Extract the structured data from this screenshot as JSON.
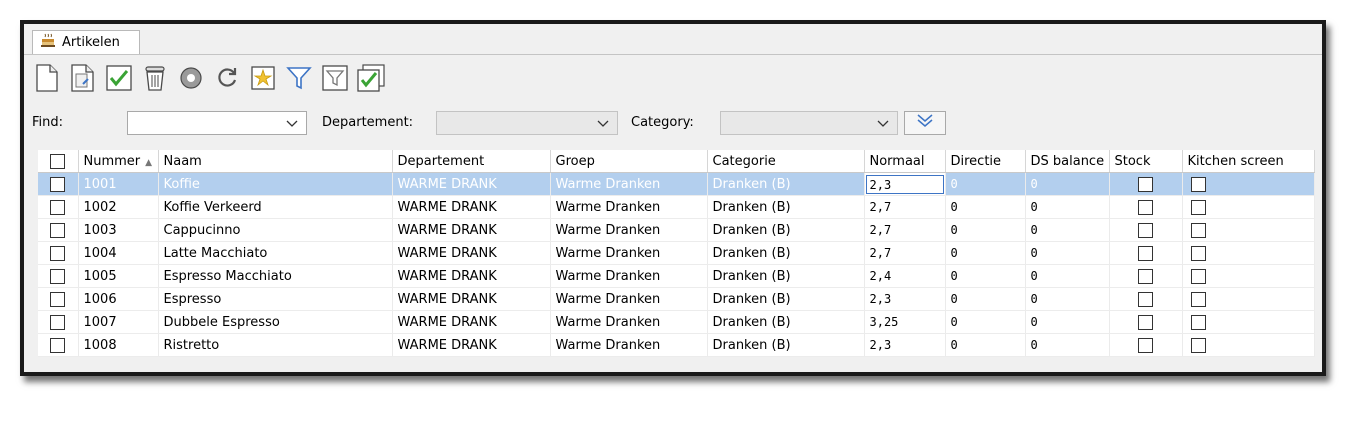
{
  "tab": {
    "label": "Artikelen",
    "icon": "coffee-cup-icon"
  },
  "toolbar": {
    "buttons": [
      {
        "name": "new-document-icon"
      },
      {
        "name": "copy-document-icon"
      },
      {
        "name": "checkmark-icon"
      },
      {
        "name": "trash-icon"
      },
      {
        "name": "reset-icon"
      },
      {
        "name": "refresh-icon"
      },
      {
        "name": "favorite-note-icon"
      },
      {
        "name": "filter-icon"
      },
      {
        "name": "filter-box-icon"
      },
      {
        "name": "multi-check-icon"
      }
    ]
  },
  "filters": {
    "find_label": "Find:",
    "find_value": "",
    "departement_label": "Departement:",
    "departement_value": "",
    "category_label": "Category:",
    "category_value": ""
  },
  "grid": {
    "columns": [
      "Nummer",
      "Naam",
      "Departement",
      "Groep",
      "Categorie",
      "Normaal",
      "Directie",
      "DS balance",
      "Stock",
      "Kitchen screen"
    ],
    "rows": [
      [
        "1001",
        "Koffie",
        "WARME DRANK",
        "Warme Dranken",
        "Dranken (B)",
        "2,3",
        "0",
        "0"
      ],
      [
        "1002",
        "Koffie Verkeerd",
        "WARME DRANK",
        "Warme Dranken",
        "Dranken (B)",
        "2,7",
        "0",
        "0"
      ],
      [
        "1003",
        "Cappucinno",
        "WARME DRANK",
        "Warme Dranken",
        "Dranken (B)",
        "2,7",
        "0",
        "0"
      ],
      [
        "1004",
        "Latte Macchiato",
        "WARME DRANK",
        "Warme Dranken",
        "Dranken (B)",
        "2,7",
        "0",
        "0"
      ],
      [
        "1005",
        "Espresso Macchiato",
        "WARME DRANK",
        "Warme Dranken",
        "Dranken (B)",
        "2,4",
        "0",
        "0"
      ],
      [
        "1006",
        "Espresso",
        "WARME DRANK",
        "Warme Dranken",
        "Dranken (B)",
        "2,3",
        "0",
        "0"
      ],
      [
        "1007",
        "Dubbele Espresso",
        "WARME DRANK",
        "Warme Dranken",
        "Dranken (B)",
        "3,25",
        "0",
        "0"
      ],
      [
        "1008",
        "Ristretto",
        "WARME DRANK",
        "Warme Dranken",
        "Dranken (B)",
        "2,3",
        "0",
        "0"
      ]
    ]
  },
  "colors": {
    "selection": "#b3cfee",
    "accent": "#3d74c5",
    "check_green": "#3aa335"
  }
}
